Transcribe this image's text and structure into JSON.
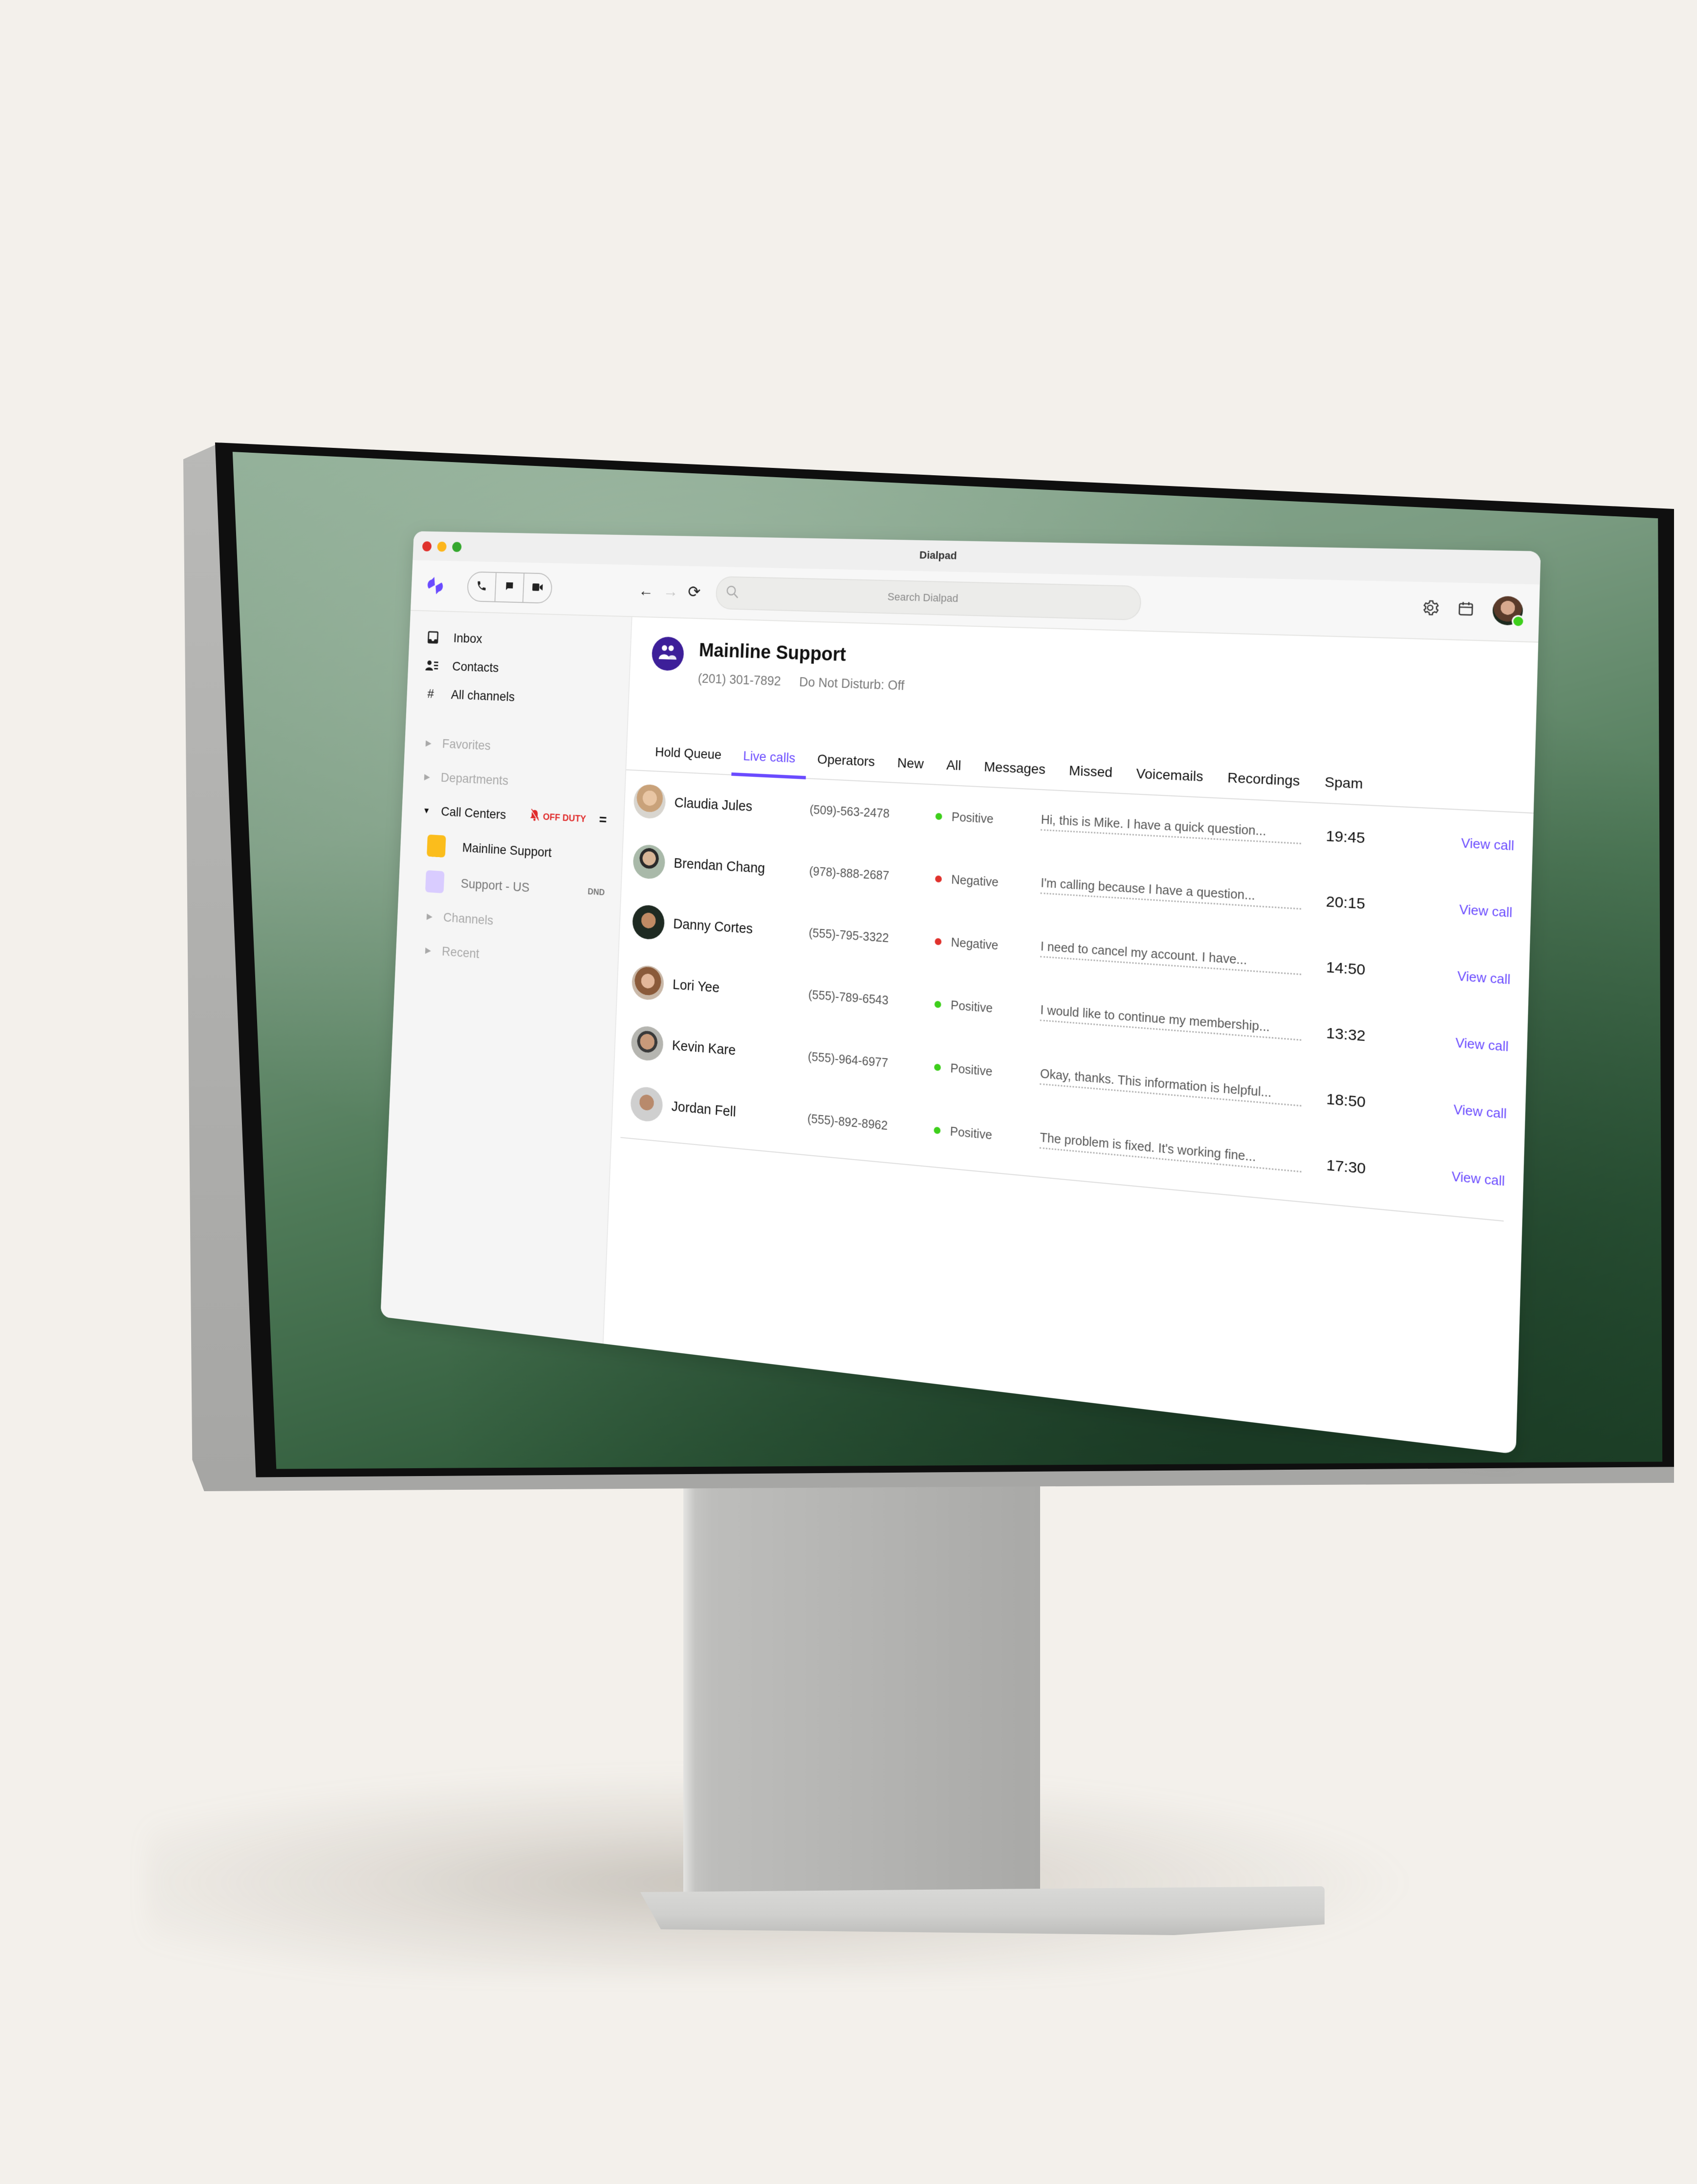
{
  "window": {
    "title": "Dialpad",
    "traffic_lights": [
      "#e0322d",
      "#fdb61c",
      "#36a82f"
    ]
  },
  "toolbar": {
    "logo_icon": "dialpad-logo-icon",
    "brand_color": "#6a4bff",
    "modes": [
      {
        "name": "phone-icon"
      },
      {
        "name": "message-icon"
      },
      {
        "name": "video-icon"
      }
    ],
    "back_glyph": "←",
    "forward_glyph": "→",
    "reload_glyph": "⟳",
    "search_placeholder": "Search Dialpad",
    "settings_icon": "gear-icon",
    "calendar_icon": "calendar-icon",
    "presence_color": "#3ecf1c"
  },
  "sidebar": {
    "nav": [
      {
        "label": "Inbox",
        "icon": "inbox-icon",
        "glyph": "▢"
      },
      {
        "label": "Contacts",
        "icon": "contacts-icon",
        "glyph": "☰"
      },
      {
        "label": "All channels",
        "icon": "hash-icon",
        "glyph": "#"
      }
    ],
    "groups_top": [
      {
        "label": "Favorites"
      },
      {
        "label": "Departments"
      }
    ],
    "call_centers": {
      "label": "Call Centers",
      "status_label": "OFF DUTY",
      "status_color": "#e02a2a",
      "menu_glyph": "=",
      "items": [
        {
          "label": "Mainline Support",
          "color": "#fbbd1c",
          "badge": ""
        },
        {
          "label": "Support - US",
          "color": "#d9ccff",
          "badge": "DND"
        }
      ]
    },
    "groups_bottom": [
      {
        "label": "Channels"
      },
      {
        "label": "Recent"
      }
    ]
  },
  "header": {
    "title": "Mainline Support",
    "phone": "(201) 301-7892",
    "dnd_status": "Do Not Disturb: Off",
    "avatar_color": "#3d1f99"
  },
  "tabs": [
    {
      "label": "Hold Queue",
      "active": false
    },
    {
      "label": "Live calls",
      "active": true
    },
    {
      "label": "Operators",
      "active": false
    },
    {
      "label": "New",
      "active": false
    },
    {
      "label": "All",
      "active": false
    },
    {
      "label": "Messages",
      "active": false
    },
    {
      "label": "Missed",
      "active": false
    },
    {
      "label": "Voicemails",
      "active": false
    },
    {
      "label": "Recordings",
      "active": false
    },
    {
      "label": "Spam",
      "active": false
    }
  ],
  "calls": [
    {
      "name": "Claudia Jules",
      "phone": "(509)-563-2478",
      "sentiment": "Positive",
      "snippet": "Hi, this is Mike. I have a quick question...",
      "duration": "19:45",
      "action": "View call"
    },
    {
      "name": "Brendan Chang",
      "phone": "(978)-888-2687",
      "sentiment": "Negative",
      "snippet": "I'm calling because I have a question...",
      "duration": "20:15",
      "action": "View call"
    },
    {
      "name": "Danny Cortes",
      "phone": "(555)-795-3322",
      "sentiment": "Negative",
      "snippet": "I need to cancel my account. I have...",
      "duration": "14:50",
      "action": "View call"
    },
    {
      "name": "Lori Yee",
      "phone": "(555)-789-6543",
      "sentiment": "Positive",
      "snippet": "I would like to continue my membership...",
      "duration": "13:32",
      "action": "View call"
    },
    {
      "name": "Kevin Kare",
      "phone": "(555)-964-6977",
      "sentiment": "Positive",
      "snippet": "Okay, thanks. This information is helpful...",
      "duration": "18:50",
      "action": "View call"
    },
    {
      "name": "Jordan Fell",
      "phone": "(555)-892-8962",
      "sentiment": "Positive",
      "snippet": "The problem is fixed. It's working fine...",
      "duration": "17:30",
      "action": "View call"
    }
  ],
  "sentiment_colors": {
    "Positive": "#3ecf1c",
    "Negative": "#e0322d"
  },
  "accent_color": "#6a4bff"
}
